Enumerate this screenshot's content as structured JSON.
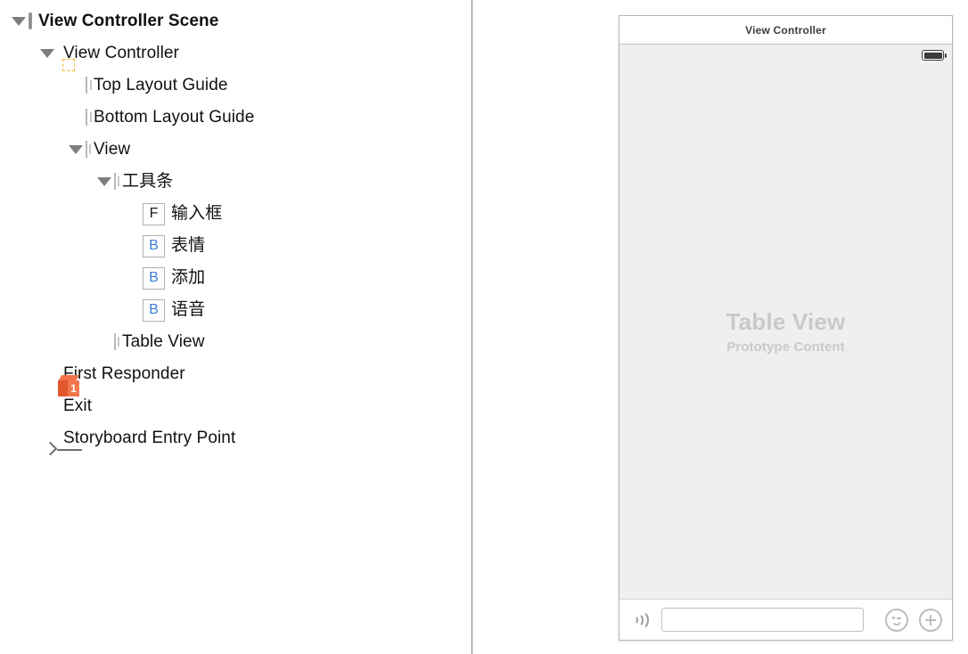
{
  "outline": {
    "rows": [
      {
        "label": "View Controller Scene",
        "icon": "scene-icon",
        "indent": 0,
        "twisty": "open",
        "bold": true
      },
      {
        "label": "View Controller",
        "icon": "view-controller-icon",
        "indent": 1,
        "twisty": "open",
        "bold": false
      },
      {
        "label": "Top Layout Guide",
        "icon": "top-layout-guide-icon",
        "indent": 2,
        "twisty": "none",
        "bold": false
      },
      {
        "label": "Bottom Layout Guide",
        "icon": "bottom-layout-guide-icon",
        "indent": 2,
        "twisty": "none",
        "bold": false
      },
      {
        "label": "View",
        "icon": "view-icon",
        "indent": 2,
        "twisty": "open",
        "bold": false
      },
      {
        "label": "工具条",
        "icon": "view-icon",
        "indent": 3,
        "twisty": "open",
        "bold": false
      },
      {
        "label": "输入框",
        "icon": "textfield-icon",
        "indent": 4,
        "twisty": "none",
        "bold": false,
        "glyph": "F"
      },
      {
        "label": "表情",
        "icon": "button-icon",
        "indent": 4,
        "twisty": "none",
        "bold": false,
        "glyph": "B"
      },
      {
        "label": "添加",
        "icon": "button-icon",
        "indent": 4,
        "twisty": "none",
        "bold": false,
        "glyph": "B"
      },
      {
        "label": "语音",
        "icon": "button-icon",
        "indent": 4,
        "twisty": "none",
        "bold": false,
        "glyph": "B"
      },
      {
        "label": "Table View",
        "icon": "table-view-icon",
        "indent": 3,
        "twisty": "none",
        "bold": false
      },
      {
        "label": "First Responder",
        "icon": "first-responder-icon",
        "indent": 1,
        "twisty": "none",
        "bold": false
      },
      {
        "label": "Exit",
        "icon": "exit-icon",
        "indent": 1,
        "twisty": "none",
        "bold": false
      },
      {
        "label": "Storyboard Entry Point",
        "icon": "entry-point-arrow-icon",
        "indent": 1,
        "twisty": "none",
        "bold": false
      }
    ]
  },
  "canvas": {
    "device": {
      "title": "View Controller",
      "status_bar": {
        "battery_icon": "battery-full-icon"
      },
      "table_view": {
        "title": "Table View",
        "subtitle": "Prototype Content"
      },
      "toolbar": {
        "voice_icon": "voice-waves-icon",
        "input_value": "",
        "input_placeholder": "",
        "emoji_icon": "smiley-face-icon",
        "add_icon": "plus-circle-icon"
      }
    },
    "entry_arrow_icon": "storyboard-entry-arrow"
  },
  "colors": {
    "view_controller_yellow": "#F7C325",
    "button_blue": "#3A7DDC",
    "responder_orange": "#EF6A3C",
    "placeholder_gray": "#C9C9C9",
    "device_screen_gray": "#EFEFEF"
  }
}
